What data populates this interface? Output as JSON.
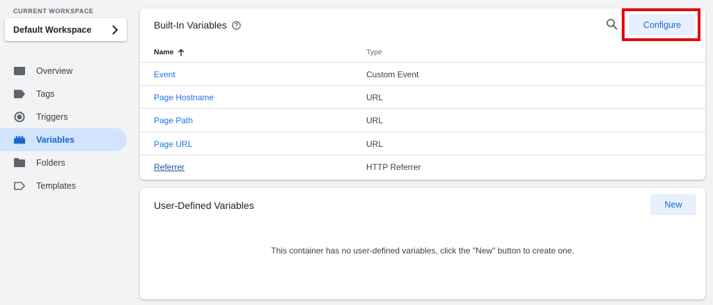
{
  "workspace": {
    "label": "CURRENT WORKSPACE",
    "name": "Default Workspace"
  },
  "nav": {
    "items": [
      {
        "label": "Overview",
        "icon": "overview-icon"
      },
      {
        "label": "Tags",
        "icon": "tag-icon"
      },
      {
        "label": "Triggers",
        "icon": "trigger-icon"
      },
      {
        "label": "Variables",
        "icon": "variables-icon",
        "active": true
      },
      {
        "label": "Folders",
        "icon": "folder-icon"
      },
      {
        "label": "Templates",
        "icon": "template-icon"
      }
    ]
  },
  "builtin": {
    "title": "Built-In Variables",
    "configure_label": "Configure",
    "columns": {
      "name": "Name",
      "type": "Type"
    },
    "rows": [
      {
        "name": "Event",
        "type": "Custom Event"
      },
      {
        "name": "Page Hostname",
        "type": "URL"
      },
      {
        "name": "Page Path",
        "type": "URL"
      },
      {
        "name": "Page URL",
        "type": "URL"
      },
      {
        "name": "Referrer",
        "type": "HTTP Referrer"
      }
    ]
  },
  "userdefined": {
    "title": "User-Defined Variables",
    "new_label": "New",
    "empty_message": "This container has no user-defined variables, click the \"New\" button to create one."
  },
  "colors": {
    "accent": "#1a73e8",
    "active_bg": "#d2e3fc",
    "highlight": "#e8000f"
  }
}
